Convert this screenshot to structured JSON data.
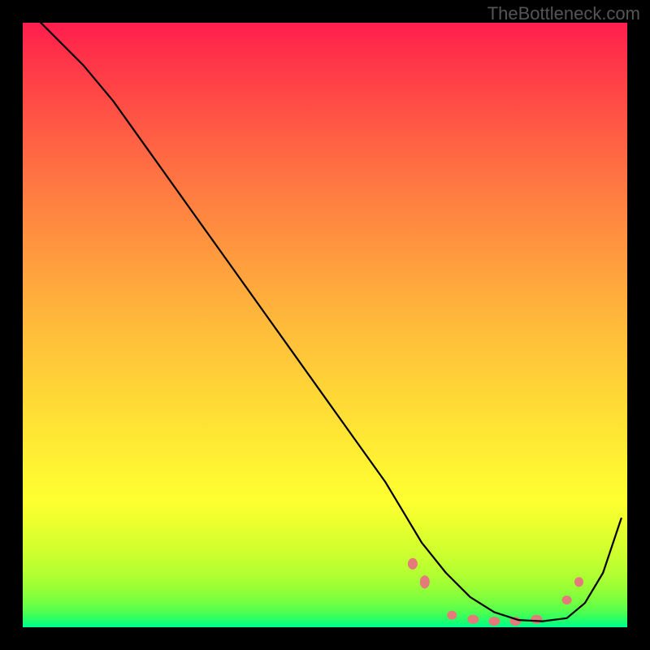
{
  "watermark": "TheBottleneck.com",
  "chart_data": {
    "type": "line",
    "title": "",
    "xlabel": "",
    "ylabel": "",
    "xlim": [
      0,
      100
    ],
    "ylim": [
      0,
      100
    ],
    "background_gradient": {
      "top": "#ff1d4d",
      "middle": "#ffe634",
      "bottom": "#00ff90"
    },
    "series": [
      {
        "name": "bottleneck-curve",
        "x": [
          3,
          6,
          10,
          15,
          20,
          25,
          30,
          35,
          40,
          45,
          50,
          55,
          60,
          63,
          66,
          70,
          74,
          78,
          82,
          86,
          90,
          93,
          96,
          99
        ],
        "y": [
          100,
          97,
          93,
          87,
          80,
          73,
          66,
          59,
          52,
          45,
          38,
          31,
          24,
          19,
          14,
          9,
          5,
          2.5,
          1.2,
          1,
          1.5,
          4,
          9,
          18
        ]
      }
    ],
    "markers": {
      "name": "highlighted-points",
      "color": "#e47a7a",
      "points": [
        {
          "x": 64.5,
          "y": 10.5,
          "rx": 6,
          "ry": 7
        },
        {
          "x": 66.5,
          "y": 7.5,
          "rx": 6,
          "ry": 8
        },
        {
          "x": 71,
          "y": 2,
          "rx": 6,
          "ry": 5.5
        },
        {
          "x": 74.5,
          "y": 1.3,
          "rx": 7,
          "ry": 5.5
        },
        {
          "x": 78,
          "y": 1,
          "rx": 7,
          "ry": 5.5
        },
        {
          "x": 81.5,
          "y": 1,
          "rx": 7,
          "ry": 5.5
        },
        {
          "x": 85,
          "y": 1.3,
          "rx": 7,
          "ry": 5.5
        },
        {
          "x": 90,
          "y": 4.5,
          "rx": 6,
          "ry": 5.5
        },
        {
          "x": 92,
          "y": 7.5,
          "rx": 5.5,
          "ry": 6
        }
      ]
    }
  }
}
